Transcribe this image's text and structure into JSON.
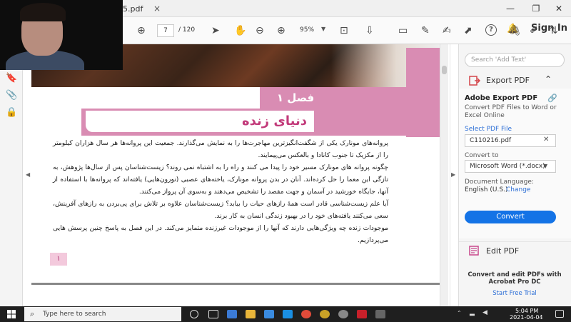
{
  "window": {
    "tab_title": "5.pdf",
    "tab_close": "×",
    "minimize": "—",
    "maximize": "❐",
    "close": "✕"
  },
  "toolbar": {
    "page_current": "7",
    "page_total": "/ 120",
    "zoom": "95%",
    "sign_in": "Sign In"
  },
  "document": {
    "chapter": "فصل ۱",
    "title": "دنیای زنده",
    "paragraphs": [
      "پروانه‌های مونارک یکی از شگفت‌انگیزترین مهاجرت‌ها را به نمایش می‌گذارند. جمعیت این پروانه‌ها هر سال هزاران کیلومتر را از مکزیک تا جنوب کانادا و بالعکس می‌پیمایند.",
      "چگونه پروانه های مونارک مسیر خود را پیدا می کنند و راه را به اشتباه نمی روند؟ زیست‌شناسان پس از سال‌ها پژوهش، به تازگی این معما را حل کرده‌اند. آنان در بدن پروانه مونارک، یاخته‌های عصبی (نورون‌هایی) یافته‌اند که پروانه‌ها با استفاده از آنها، جایگاه خورشید در آسمان و جهت مقصد را تشخیص می‌دهند و به‌سوی آن پرواز می‌کنند.",
      "آیا علم زیست‌شناسی قادر است همهٔ رازهای حیات را بیابد؟ زیست‌شناسان علاوه بر تلاش برای پی‌بردن به رازهای آفرینش، سعی می‌کنند یافته‌های خود را در بهبود زندگی انسان به کار برند.",
      "موجودات زنده چه ویژگی‌هایی دارند که آنها را از موجودات غیرزنده متمایز می‌کند. در این فصل به پاسخ چنین پرسش هایی می‌پردازیم."
    ],
    "page_number": "۱"
  },
  "right_panel": {
    "search_placeholder": "Search 'Add Text'",
    "export_label": "Export PDF",
    "card_title": "Adobe Export PDF",
    "card_desc": "Convert PDF Files to Word or Excel Online",
    "select_pdf_label": "Select PDF File",
    "pdf_file": "C110216.pdf",
    "convert_to_label": "Convert to",
    "convert_to_value": "Microsoft Word (*.docx)",
    "doc_lang_label": "Document Language:",
    "doc_lang_value": "English (U.S.)",
    "change_link": "Change",
    "convert_button": "Convert",
    "edit_pdf_label": "Edit PDF",
    "promo_text": "Convert and edit PDFs with Acrobat Pro DC",
    "free_trial": "Start Free Trial"
  },
  "taskbar": {
    "search_placeholder": "Type here to search",
    "time": "5:04 PM",
    "date": "2021-04-04"
  },
  "colors": {
    "accent_pink": "#d98cb3",
    "title_magenta": "#c23a7a",
    "adobe_blue": "#1473e6",
    "taskbar": "#1f1f1f"
  }
}
